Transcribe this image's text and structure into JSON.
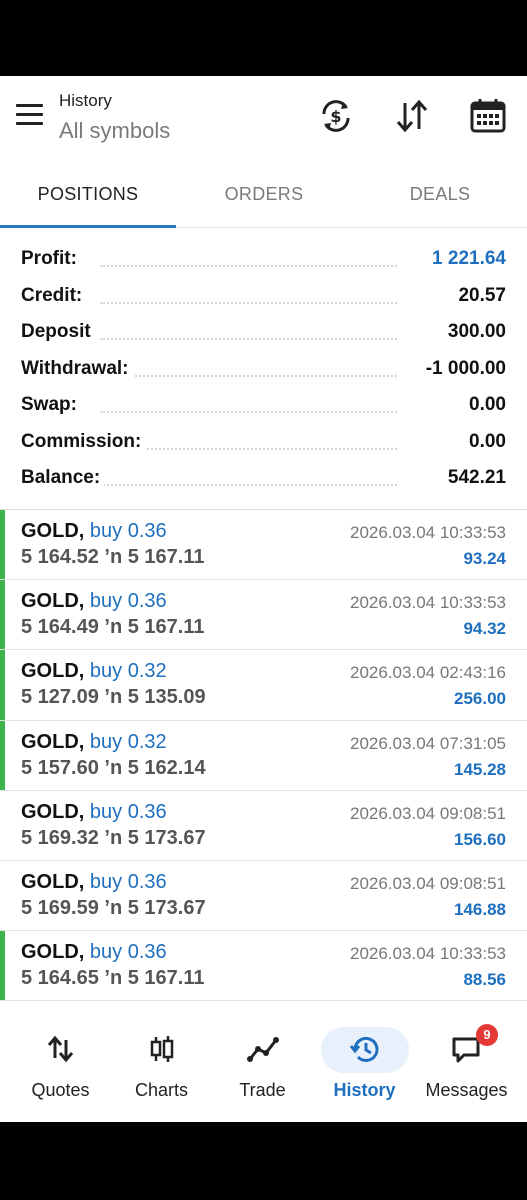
{
  "header": {
    "subtitle": "History",
    "title": "All symbols",
    "icons": [
      "currency-exchange-icon",
      "sort-icon",
      "calendar-icon"
    ]
  },
  "tabs": [
    {
      "label": "POSITIONS",
      "active": true
    },
    {
      "label": "ORDERS",
      "active": false
    },
    {
      "label": "DEALS",
      "active": false
    }
  ],
  "summary": [
    {
      "label": "Profit:",
      "value": "1 221.64",
      "highlight": true
    },
    {
      "label": "Credit:",
      "value": "20.57"
    },
    {
      "label": "Deposit",
      "value": "300.00"
    },
    {
      "label": "Withdrawal:",
      "value": "-1 000.00"
    },
    {
      "label": "Swap:",
      "value": "0.00"
    },
    {
      "label": "Commission:",
      "value": "0.00"
    },
    {
      "label": "Balance:",
      "value": "542.21"
    }
  ],
  "trades": [
    {
      "symbol": "GOLD,",
      "side": "buy 0.36",
      "prices": "5 164.52 ’n  5 167.11",
      "time": "2026.03.04 10:33:53",
      "profit": "93.24",
      "marker": true
    },
    {
      "symbol": "GOLD,",
      "side": "buy 0.36",
      "prices": "5 164.49 ’n  5 167.11",
      "time": "2026.03.04 10:33:53",
      "profit": "94.32",
      "marker": true
    },
    {
      "symbol": "GOLD,",
      "side": "buy 0.32",
      "prices": "5 127.09 ’n  5 135.09",
      "time": "2026.03.04 02:43:16",
      "profit": "256.00",
      "marker": true
    },
    {
      "symbol": "GOLD,",
      "side": "buy 0.32",
      "prices": "5 157.60 ’n  5 162.14",
      "time": "2026.03.04 07:31:05",
      "profit": "145.28",
      "marker": true
    },
    {
      "symbol": "GOLD,",
      "side": "buy 0.36",
      "prices": "5 169.32 ’n  5 173.67",
      "time": "2026.03.04 09:08:51",
      "profit": "156.60",
      "marker": false
    },
    {
      "symbol": "GOLD,",
      "side": "buy 0.36",
      "prices": "5 169.59 ’n  5 173.67",
      "time": "2026.03.04 09:08:51",
      "profit": "146.88",
      "marker": false
    },
    {
      "symbol": "GOLD,",
      "side": "buy 0.36",
      "prices": "5 164.65 ’n  5 167.11",
      "time": "2026.03.04 10:33:53",
      "profit": "88.56",
      "marker": true
    }
  ],
  "nav": [
    {
      "label": "Quotes",
      "icon": "quotes-icon",
      "active": false
    },
    {
      "label": "Charts",
      "icon": "charts-icon",
      "active": false
    },
    {
      "label": "Trade",
      "icon": "trade-icon",
      "active": false
    },
    {
      "label": "History",
      "icon": "history-icon",
      "active": true
    },
    {
      "label": "Messages",
      "icon": "messages-icon",
      "active": false,
      "badge": "9"
    }
  ],
  "colors": {
    "accent": "#1f6fbf",
    "marker_green": "#3db44a",
    "badge_red": "#e53935"
  }
}
